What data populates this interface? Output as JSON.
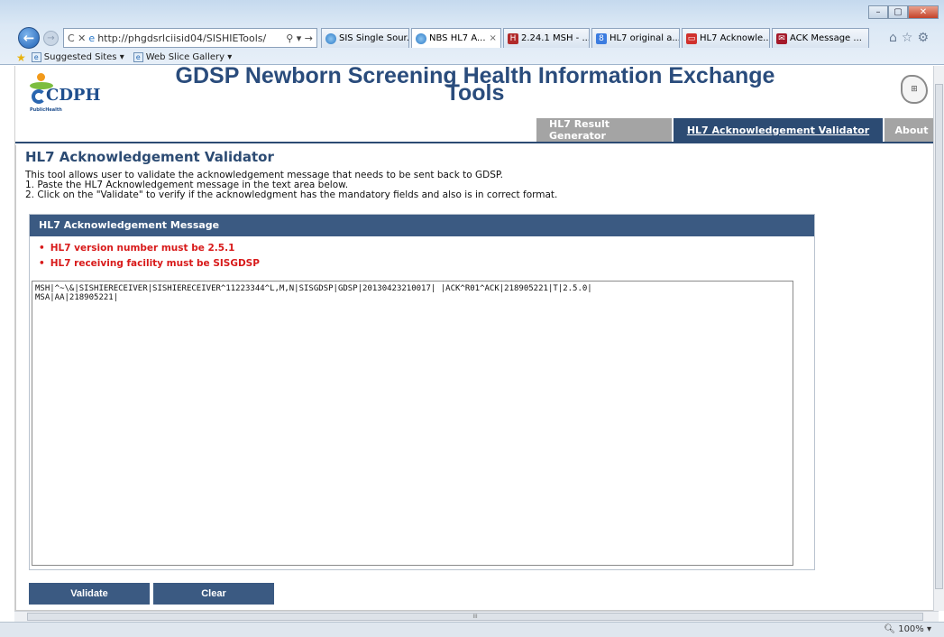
{
  "window": {
    "min": "–",
    "max": "▢",
    "close": "✕"
  },
  "browser": {
    "url": "http://phgdsrlciisid04/SISHIETools/",
    "addr_tools": "⚲ ▾ →",
    "tabs": [
      {
        "label": "SIS Single Sour...",
        "icon": "ie-icon"
      },
      {
        "label": "NBS HL7 A...",
        "icon": "ie-icon",
        "active": true
      },
      {
        "label": "2.24.1 MSH - ...",
        "icon": "hl7-icon"
      },
      {
        "label": "HL7 original a...",
        "icon": "google-icon"
      },
      {
        "label": "HL7 Acknowle...",
        "icon": "mail-icon"
      },
      {
        "label": "ACK Message ...",
        "icon": "ack-icon"
      }
    ],
    "favorites": {
      "suggested": "Suggested Sites ▾",
      "webslice": "Web Slice Gallery ▾"
    },
    "zoom": "100%"
  },
  "site": {
    "title_line1": "GDSP Newborn Screening Health Information Exchange",
    "title_line2": "Tools",
    "logo_text": "CDPH",
    "logo_sub": "PublicHealth",
    "nav": [
      {
        "label": "HL7 Result Generator"
      },
      {
        "label": "HL7 Acknowledgement Validator",
        "active": true
      },
      {
        "label": "About"
      }
    ]
  },
  "main": {
    "page_title": "HL7 Acknowledgement Validator",
    "intro": [
      "This tool allows user to validate the acknowledgement message that needs to be sent back to GDSP.",
      "1. Paste the HL7 Acknowledgement message in the text area below.",
      "2. Click on the \"Validate\" to verify if the acknowledgment has the mandatory fields and also is in correct format."
    ],
    "panel_title": "HL7 Acknowledgement Message",
    "errors": [
      "HL7 version number must be 2.5.1",
      "HL7 receiving facility must be SISGDSP"
    ],
    "message": "MSH|^~\\&|SISHIERECEIVER|SISHIERECEIVER^11223344^L,M,N|SISGDSP|GDSP|20130423210017| |ACK^R01^ACK|218905221|T|2.5.0|\nMSA|AA|218905221|",
    "validate_label": "Validate",
    "clear_label": "Clear"
  }
}
